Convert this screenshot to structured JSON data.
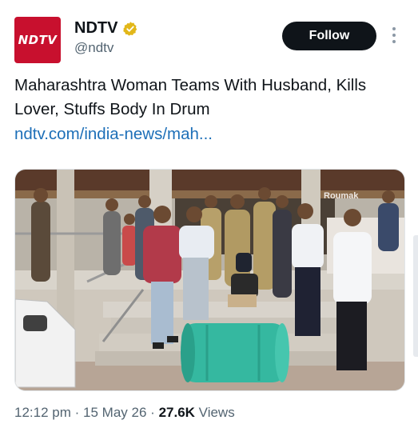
{
  "account": {
    "avatar_text": "NDTV",
    "name": "NDTV",
    "handle": "@ndtv",
    "verified_icon": "verified-badge-icon",
    "follow_label": "Follow",
    "more_icon": "more-vertical-icon"
  },
  "post": {
    "headline": "Maharashtra Woman Teams With Husband, Kills Lover, Stuffs Body In Drum",
    "link": "ndtv.com/india-news/mah...",
    "image_overlay_text": "Roumak",
    "time": "12:12 pm",
    "date": "15 May 26",
    "views_count": "27.6K",
    "views_label": "Views",
    "separator": "·"
  },
  "colors": {
    "brand_red": "#c8102e",
    "follow_bg": "#0f1419",
    "link": "#1d6fb8",
    "muted": "#536471",
    "verified_gold": "#e2b719"
  }
}
